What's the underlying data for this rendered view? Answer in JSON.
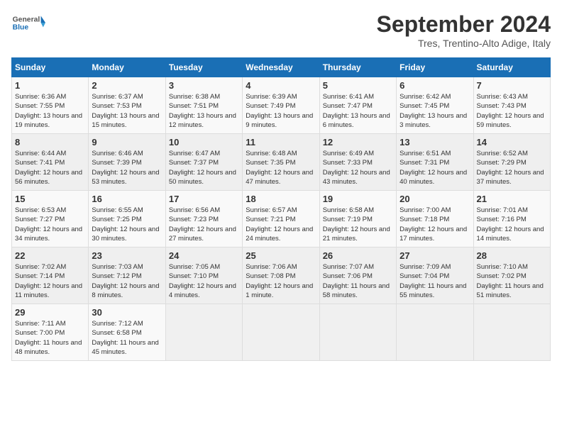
{
  "header": {
    "logo_general": "General",
    "logo_blue": "Blue",
    "month_title": "September 2024",
    "subtitle": "Tres, Trentino-Alto Adige, Italy"
  },
  "days_of_week": [
    "Sunday",
    "Monday",
    "Tuesday",
    "Wednesday",
    "Thursday",
    "Friday",
    "Saturday"
  ],
  "weeks": [
    [
      {
        "day": "1",
        "sunrise": "6:36 AM",
        "sunset": "7:55 PM",
        "daylight": "13 hours and 19 minutes."
      },
      {
        "day": "2",
        "sunrise": "6:37 AM",
        "sunset": "7:53 PM",
        "daylight": "13 hours and 15 minutes."
      },
      {
        "day": "3",
        "sunrise": "6:38 AM",
        "sunset": "7:51 PM",
        "daylight": "13 hours and 12 minutes."
      },
      {
        "day": "4",
        "sunrise": "6:39 AM",
        "sunset": "7:49 PM",
        "daylight": "13 hours and 9 minutes."
      },
      {
        "day": "5",
        "sunrise": "6:41 AM",
        "sunset": "7:47 PM",
        "daylight": "13 hours and 6 minutes."
      },
      {
        "day": "6",
        "sunrise": "6:42 AM",
        "sunset": "7:45 PM",
        "daylight": "13 hours and 3 minutes."
      },
      {
        "day": "7",
        "sunrise": "6:43 AM",
        "sunset": "7:43 PM",
        "daylight": "12 hours and 59 minutes."
      }
    ],
    [
      {
        "day": "8",
        "sunrise": "6:44 AM",
        "sunset": "7:41 PM",
        "daylight": "12 hours and 56 minutes."
      },
      {
        "day": "9",
        "sunrise": "6:46 AM",
        "sunset": "7:39 PM",
        "daylight": "12 hours and 53 minutes."
      },
      {
        "day": "10",
        "sunrise": "6:47 AM",
        "sunset": "7:37 PM",
        "daylight": "12 hours and 50 minutes."
      },
      {
        "day": "11",
        "sunrise": "6:48 AM",
        "sunset": "7:35 PM",
        "daylight": "12 hours and 47 minutes."
      },
      {
        "day": "12",
        "sunrise": "6:49 AM",
        "sunset": "7:33 PM",
        "daylight": "12 hours and 43 minutes."
      },
      {
        "day": "13",
        "sunrise": "6:51 AM",
        "sunset": "7:31 PM",
        "daylight": "12 hours and 40 minutes."
      },
      {
        "day": "14",
        "sunrise": "6:52 AM",
        "sunset": "7:29 PM",
        "daylight": "12 hours and 37 minutes."
      }
    ],
    [
      {
        "day": "15",
        "sunrise": "6:53 AM",
        "sunset": "7:27 PM",
        "daylight": "12 hours and 34 minutes."
      },
      {
        "day": "16",
        "sunrise": "6:55 AM",
        "sunset": "7:25 PM",
        "daylight": "12 hours and 30 minutes."
      },
      {
        "day": "17",
        "sunrise": "6:56 AM",
        "sunset": "7:23 PM",
        "daylight": "12 hours and 27 minutes."
      },
      {
        "day": "18",
        "sunrise": "6:57 AM",
        "sunset": "7:21 PM",
        "daylight": "12 hours and 24 minutes."
      },
      {
        "day": "19",
        "sunrise": "6:58 AM",
        "sunset": "7:19 PM",
        "daylight": "12 hours and 21 minutes."
      },
      {
        "day": "20",
        "sunrise": "7:00 AM",
        "sunset": "7:18 PM",
        "daylight": "12 hours and 17 minutes."
      },
      {
        "day": "21",
        "sunrise": "7:01 AM",
        "sunset": "7:16 PM",
        "daylight": "12 hours and 14 minutes."
      }
    ],
    [
      {
        "day": "22",
        "sunrise": "7:02 AM",
        "sunset": "7:14 PM",
        "daylight": "12 hours and 11 minutes."
      },
      {
        "day": "23",
        "sunrise": "7:03 AM",
        "sunset": "7:12 PM",
        "daylight": "12 hours and 8 minutes."
      },
      {
        "day": "24",
        "sunrise": "7:05 AM",
        "sunset": "7:10 PM",
        "daylight": "12 hours and 4 minutes."
      },
      {
        "day": "25",
        "sunrise": "7:06 AM",
        "sunset": "7:08 PM",
        "daylight": "12 hours and 1 minute."
      },
      {
        "day": "26",
        "sunrise": "7:07 AM",
        "sunset": "7:06 PM",
        "daylight": "11 hours and 58 minutes."
      },
      {
        "day": "27",
        "sunrise": "7:09 AM",
        "sunset": "7:04 PM",
        "daylight": "11 hours and 55 minutes."
      },
      {
        "day": "28",
        "sunrise": "7:10 AM",
        "sunset": "7:02 PM",
        "daylight": "11 hours and 51 minutes."
      }
    ],
    [
      {
        "day": "29",
        "sunrise": "7:11 AM",
        "sunset": "7:00 PM",
        "daylight": "11 hours and 48 minutes."
      },
      {
        "day": "30",
        "sunrise": "7:12 AM",
        "sunset": "6:58 PM",
        "daylight": "11 hours and 45 minutes."
      },
      null,
      null,
      null,
      null,
      null
    ]
  ]
}
